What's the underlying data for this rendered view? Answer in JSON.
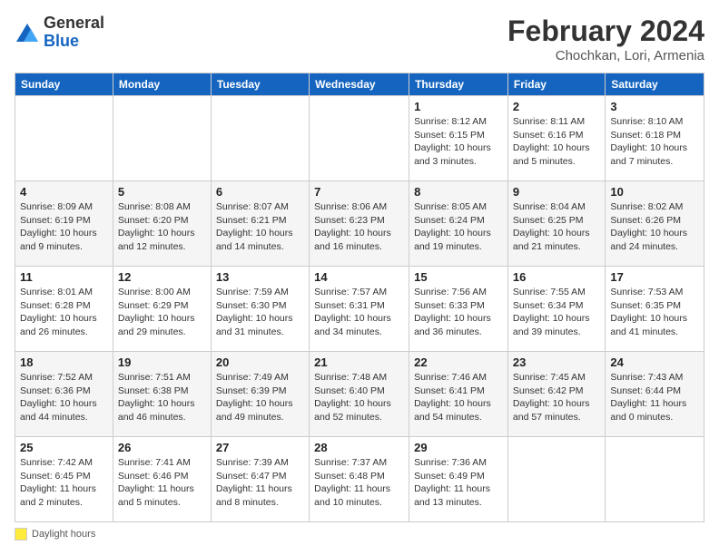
{
  "header": {
    "logo_general": "General",
    "logo_blue": "Blue",
    "month_year": "February 2024",
    "location": "Chochkan, Lori, Armenia"
  },
  "legend": {
    "label": "Daylight hours"
  },
  "days": [
    "Sunday",
    "Monday",
    "Tuesday",
    "Wednesday",
    "Thursday",
    "Friday",
    "Saturday"
  ],
  "weeks": [
    [
      {
        "num": "",
        "detail": ""
      },
      {
        "num": "",
        "detail": ""
      },
      {
        "num": "",
        "detail": ""
      },
      {
        "num": "",
        "detail": ""
      },
      {
        "num": "1",
        "detail": "Sunrise: 8:12 AM\nSunset: 6:15 PM\nDaylight: 10 hours\nand 3 minutes."
      },
      {
        "num": "2",
        "detail": "Sunrise: 8:11 AM\nSunset: 6:16 PM\nDaylight: 10 hours\nand 5 minutes."
      },
      {
        "num": "3",
        "detail": "Sunrise: 8:10 AM\nSunset: 6:18 PM\nDaylight: 10 hours\nand 7 minutes."
      }
    ],
    [
      {
        "num": "4",
        "detail": "Sunrise: 8:09 AM\nSunset: 6:19 PM\nDaylight: 10 hours\nand 9 minutes."
      },
      {
        "num": "5",
        "detail": "Sunrise: 8:08 AM\nSunset: 6:20 PM\nDaylight: 10 hours\nand 12 minutes."
      },
      {
        "num": "6",
        "detail": "Sunrise: 8:07 AM\nSunset: 6:21 PM\nDaylight: 10 hours\nand 14 minutes."
      },
      {
        "num": "7",
        "detail": "Sunrise: 8:06 AM\nSunset: 6:23 PM\nDaylight: 10 hours\nand 16 minutes."
      },
      {
        "num": "8",
        "detail": "Sunrise: 8:05 AM\nSunset: 6:24 PM\nDaylight: 10 hours\nand 19 minutes."
      },
      {
        "num": "9",
        "detail": "Sunrise: 8:04 AM\nSunset: 6:25 PM\nDaylight: 10 hours\nand 21 minutes."
      },
      {
        "num": "10",
        "detail": "Sunrise: 8:02 AM\nSunset: 6:26 PM\nDaylight: 10 hours\nand 24 minutes."
      }
    ],
    [
      {
        "num": "11",
        "detail": "Sunrise: 8:01 AM\nSunset: 6:28 PM\nDaylight: 10 hours\nand 26 minutes."
      },
      {
        "num": "12",
        "detail": "Sunrise: 8:00 AM\nSunset: 6:29 PM\nDaylight: 10 hours\nand 29 minutes."
      },
      {
        "num": "13",
        "detail": "Sunrise: 7:59 AM\nSunset: 6:30 PM\nDaylight: 10 hours\nand 31 minutes."
      },
      {
        "num": "14",
        "detail": "Sunrise: 7:57 AM\nSunset: 6:31 PM\nDaylight: 10 hours\nand 34 minutes."
      },
      {
        "num": "15",
        "detail": "Sunrise: 7:56 AM\nSunset: 6:33 PM\nDaylight: 10 hours\nand 36 minutes."
      },
      {
        "num": "16",
        "detail": "Sunrise: 7:55 AM\nSunset: 6:34 PM\nDaylight: 10 hours\nand 39 minutes."
      },
      {
        "num": "17",
        "detail": "Sunrise: 7:53 AM\nSunset: 6:35 PM\nDaylight: 10 hours\nand 41 minutes."
      }
    ],
    [
      {
        "num": "18",
        "detail": "Sunrise: 7:52 AM\nSunset: 6:36 PM\nDaylight: 10 hours\nand 44 minutes."
      },
      {
        "num": "19",
        "detail": "Sunrise: 7:51 AM\nSunset: 6:38 PM\nDaylight: 10 hours\nand 46 minutes."
      },
      {
        "num": "20",
        "detail": "Sunrise: 7:49 AM\nSunset: 6:39 PM\nDaylight: 10 hours\nand 49 minutes."
      },
      {
        "num": "21",
        "detail": "Sunrise: 7:48 AM\nSunset: 6:40 PM\nDaylight: 10 hours\nand 52 minutes."
      },
      {
        "num": "22",
        "detail": "Sunrise: 7:46 AM\nSunset: 6:41 PM\nDaylight: 10 hours\nand 54 minutes."
      },
      {
        "num": "23",
        "detail": "Sunrise: 7:45 AM\nSunset: 6:42 PM\nDaylight: 10 hours\nand 57 minutes."
      },
      {
        "num": "24",
        "detail": "Sunrise: 7:43 AM\nSunset: 6:44 PM\nDaylight: 11 hours\nand 0 minutes."
      }
    ],
    [
      {
        "num": "25",
        "detail": "Sunrise: 7:42 AM\nSunset: 6:45 PM\nDaylight: 11 hours\nand 2 minutes."
      },
      {
        "num": "26",
        "detail": "Sunrise: 7:41 AM\nSunset: 6:46 PM\nDaylight: 11 hours\nand 5 minutes."
      },
      {
        "num": "27",
        "detail": "Sunrise: 7:39 AM\nSunset: 6:47 PM\nDaylight: 11 hours\nand 8 minutes."
      },
      {
        "num": "28",
        "detail": "Sunrise: 7:37 AM\nSunset: 6:48 PM\nDaylight: 11 hours\nand 10 minutes."
      },
      {
        "num": "29",
        "detail": "Sunrise: 7:36 AM\nSunset: 6:49 PM\nDaylight: 11 hours\nand 13 minutes."
      },
      {
        "num": "",
        "detail": ""
      },
      {
        "num": "",
        "detail": ""
      }
    ]
  ]
}
